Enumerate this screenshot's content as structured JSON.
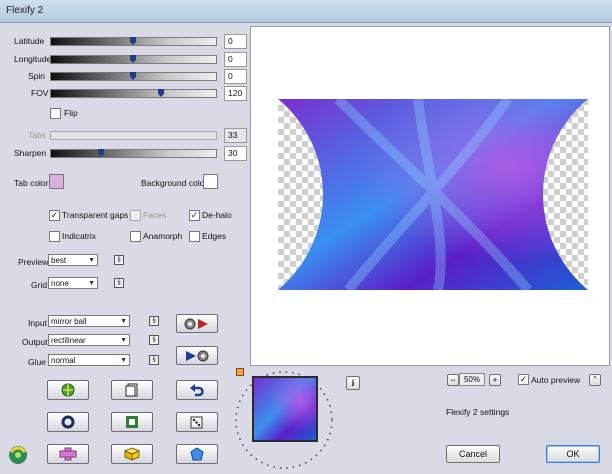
{
  "window": {
    "title": "Flexify 2"
  },
  "sliders": [
    {
      "label": "Latitude",
      "value": "0",
      "level": 0.5
    },
    {
      "label": "Longitude",
      "value": "0",
      "level": 0.5
    },
    {
      "label": "Spin",
      "value": "0",
      "level": 0.5
    },
    {
      "label": "FOV",
      "value": "120",
      "level": 0.67
    }
  ],
  "flip": {
    "label": "Flip",
    "checked": false
  },
  "tabs": {
    "label": "Tabs",
    "value": "33",
    "enabled": false
  },
  "sharpen": {
    "label": "Sharpen",
    "value": "30",
    "level": 0.3
  },
  "colors": {
    "tab_label": "Tab color",
    "tab_color": "#dcaee0",
    "bg_label": "Background color",
    "bg_color": "#ffffff"
  },
  "options": {
    "transparent_gaps": {
      "label": "Transparent gaps",
      "checked": true
    },
    "faces": {
      "label": "Faces",
      "checked": false,
      "enabled": false
    },
    "dehalo": {
      "label": "De-halo",
      "checked": true
    },
    "indicatrix": {
      "label": "Indicatrix",
      "checked": false
    },
    "anamorph": {
      "label": "Anamorph",
      "checked": false
    },
    "edges": {
      "label": "Edges",
      "checked": false
    }
  },
  "preview_mode": {
    "label": "Preview",
    "value": "best"
  },
  "grid": {
    "label": "Grid",
    "value": "none"
  },
  "input": {
    "label": "Input",
    "value": "mirror ball"
  },
  "output": {
    "label": "Output",
    "value": "rectilinear"
  },
  "glue": {
    "label": "Glue",
    "value": "normal"
  },
  "zoom": {
    "value": "50%",
    "minus": "−",
    "plus": "+"
  },
  "auto_preview": {
    "label": "Auto preview",
    "checked": true
  },
  "info_icon": "i",
  "settings_label": "Flexify 2 settings",
  "buttons": {
    "cancel": "Cancel",
    "ok": "OK"
  },
  "accent_colors": {
    "preview_purple": "#7a2fd0",
    "preview_blue": "#1d5fd4",
    "ok_border": "#3a7bd5"
  }
}
